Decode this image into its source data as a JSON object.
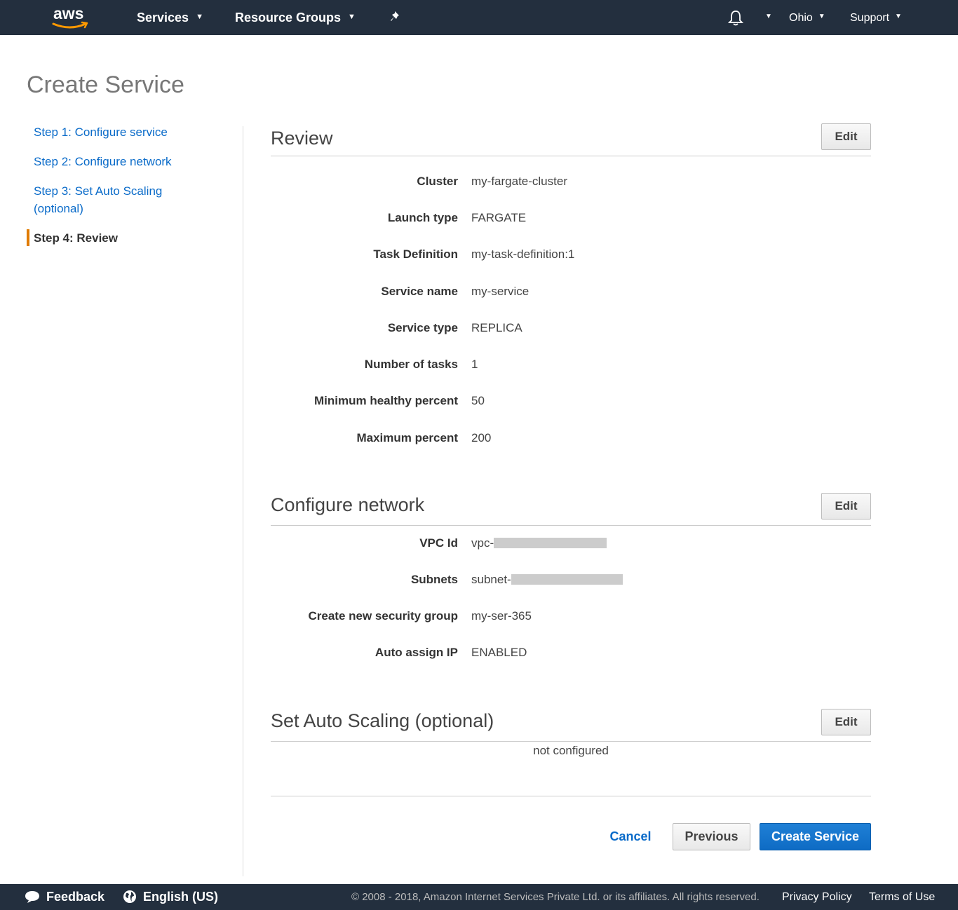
{
  "topnav": {
    "logo_text": "aws",
    "services": "Services",
    "resource_groups": "Resource Groups",
    "region": "Ohio",
    "support": "Support",
    "caret": "▼"
  },
  "page": {
    "title": "Create Service"
  },
  "sidebar": {
    "steps": [
      {
        "label": "Step 1: Configure service"
      },
      {
        "label": "Step 2: Configure network"
      },
      {
        "label": "Step 3: Set Auto Scaling (optional)"
      },
      {
        "label": "Step 4: Review"
      }
    ]
  },
  "review": {
    "title": "Review",
    "edit": "Edit",
    "fields": [
      {
        "label": "Cluster",
        "value": "my-fargate-cluster"
      },
      {
        "label": "Launch type",
        "value": "FARGATE"
      },
      {
        "label": "Task Definition",
        "value": "my-task-definition:1"
      },
      {
        "label": "Service name",
        "value": "my-service"
      },
      {
        "label": "Service type",
        "value": "REPLICA"
      },
      {
        "label": "Number of tasks",
        "value": "1"
      },
      {
        "label": "Minimum healthy percent",
        "value": "50"
      },
      {
        "label": "Maximum percent",
        "value": "200"
      }
    ]
  },
  "network": {
    "title": "Configure network",
    "edit": "Edit",
    "fields": [
      {
        "label": "VPC Id",
        "value": "vpc-"
      },
      {
        "label": "Subnets",
        "value": "subnet-"
      },
      {
        "label": "Create new security group",
        "value": "my-ser-365"
      },
      {
        "label": "Auto assign IP",
        "value": "ENABLED"
      }
    ]
  },
  "autoscaling": {
    "title": "Set Auto Scaling (optional)",
    "edit": "Edit",
    "status": "not configured"
  },
  "actions": {
    "cancel": "Cancel",
    "previous": "Previous",
    "create": "Create Service"
  },
  "footer": {
    "feedback": "Feedback",
    "language": "English (US)",
    "copyright": "© 2008 - 2018, Amazon Internet Services Private Ltd. or its affiliates. All rights reserved.",
    "privacy": "Privacy Policy",
    "terms": "Terms of Use"
  },
  "colors": {
    "nav_bg": "#232f3e",
    "link": "#0a6bc9",
    "accent": "#e07b00",
    "primary_button": "#1f80d6"
  }
}
